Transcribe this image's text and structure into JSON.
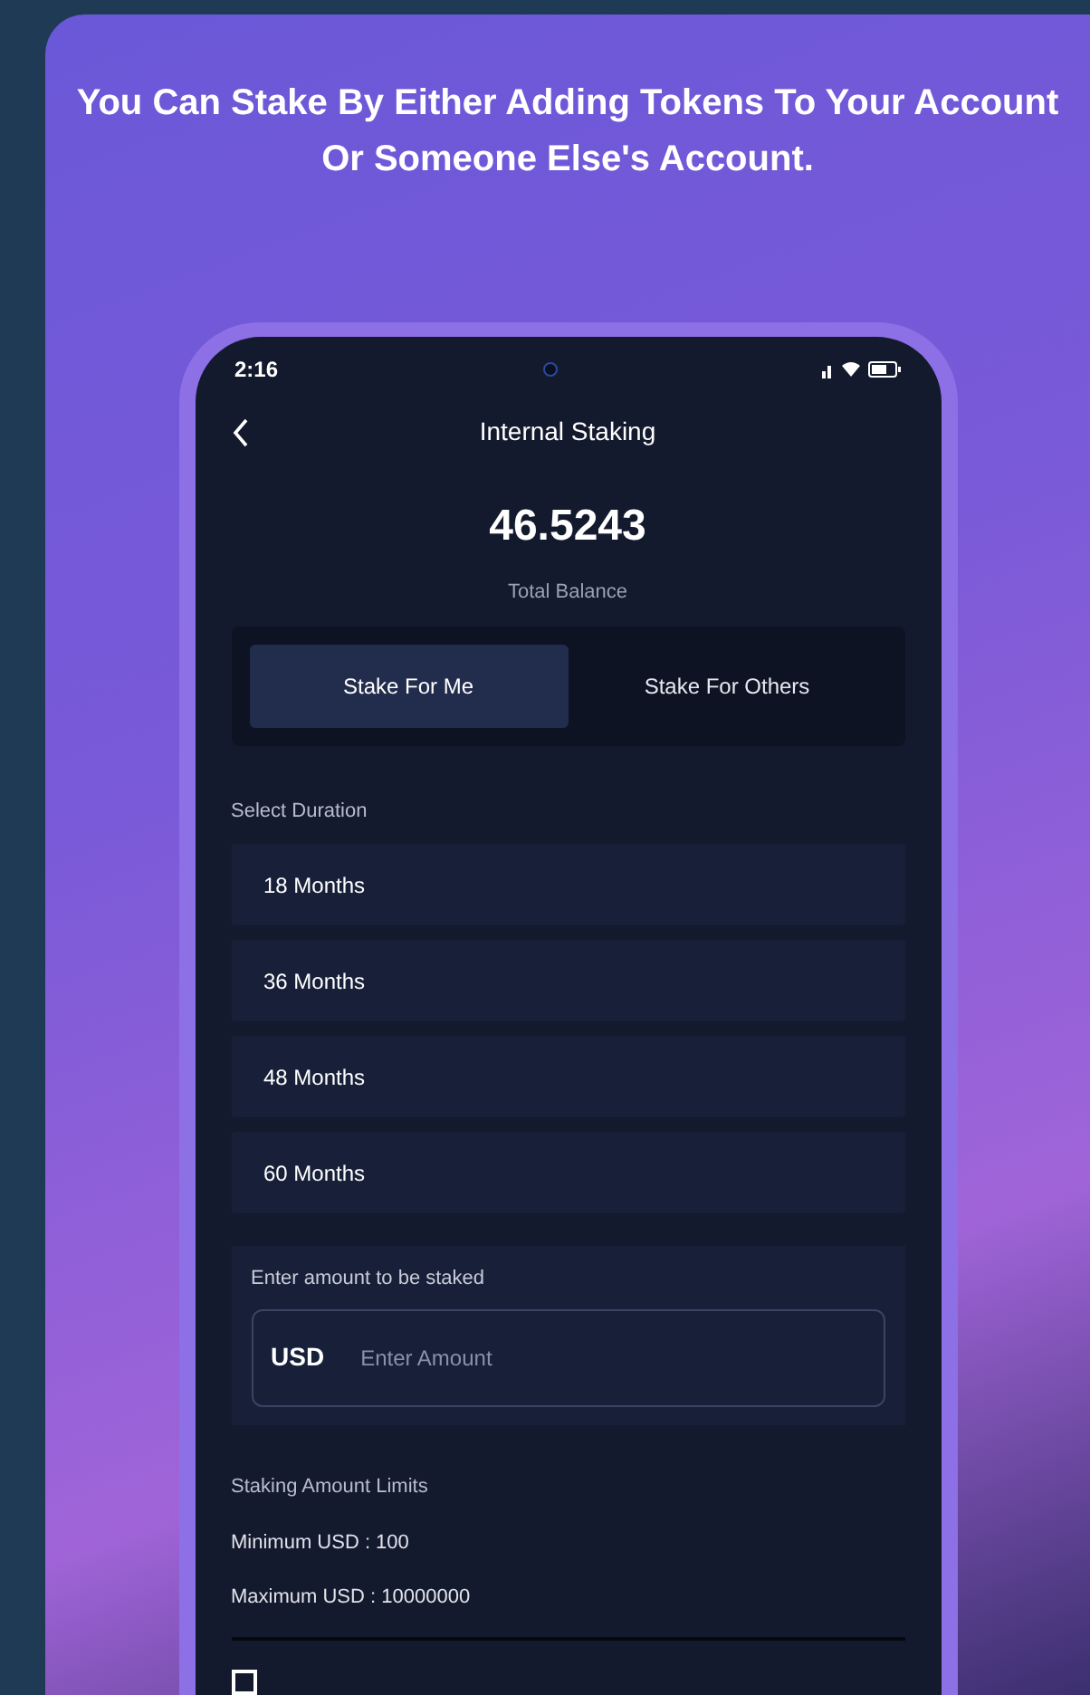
{
  "headline": "You Can Stake By Either Adding Tokens To Your Account Or Someone Else's Account.",
  "status_bar": {
    "time": "2:16"
  },
  "header": {
    "title": "Internal Staking"
  },
  "balance": {
    "amount": "46.5243",
    "label": "Total Balance"
  },
  "tabs": [
    {
      "label": "Stake For Me",
      "selected": true
    },
    {
      "label": "Stake For Others",
      "selected": false
    }
  ],
  "duration": {
    "label": "Select Duration",
    "options": [
      {
        "label": "18 Months",
        "selected": false
      },
      {
        "label": "36 Months",
        "selected": false
      },
      {
        "label": "48 Months",
        "selected": false
      },
      {
        "label": "60 Months",
        "selected": false
      }
    ]
  },
  "amount": {
    "label": "Enter amount to be staked",
    "currency": "USD",
    "placeholder": "Enter Amount"
  },
  "limits": {
    "title": "Staking Amount Limits",
    "minimum": "Minimum USD : 100",
    "maximum": "Maximum USD : 10000000"
  },
  "agreement": {
    "checked": false
  }
}
